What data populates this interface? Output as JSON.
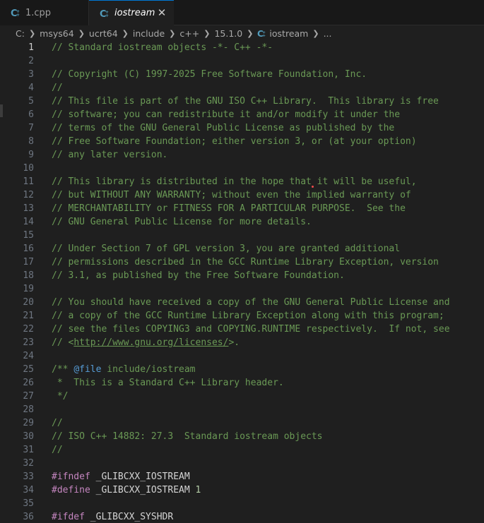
{
  "tabs": [
    {
      "label": "1.cpp",
      "icon": "cpp-file-icon"
    },
    {
      "label": "iostream",
      "icon": "cpp-file-icon",
      "close": "✕"
    }
  ],
  "colors": {
    "cpp_icon": "#519aba",
    "comment": "#6a9955",
    "keyword": "#c586c0",
    "number": "#b5cea8",
    "doc_tag": "#569cd6"
  },
  "breadcrumb": [
    "C:",
    "msys64",
    "ucrt64",
    "include",
    "c++",
    "15.1.0",
    "iostream",
    "..."
  ],
  "lines": [
    {
      "n": "1",
      "text": "// Standard iostream objects -*- C++ -*-"
    },
    {
      "n": "2",
      "text": ""
    },
    {
      "n": "3",
      "text": "// Copyright (C) 1997-2025 Free Software Foundation, Inc."
    },
    {
      "n": "4",
      "text": "//"
    },
    {
      "n": "5",
      "text": "// This file is part of the GNU ISO C++ Library.  This library is free"
    },
    {
      "n": "6",
      "text": "// software; you can redistribute it and/or modify it under the"
    },
    {
      "n": "7",
      "text": "// terms of the GNU General Public License as published by the"
    },
    {
      "n": "8",
      "text": "// Free Software Foundation; either version 3, or (at your option)"
    },
    {
      "n": "9",
      "text": "// any later version."
    },
    {
      "n": "10",
      "text": ""
    },
    {
      "n": "11",
      "text": "// This library is distributed in the hope that it will be useful,"
    },
    {
      "n": "12",
      "text": "// but WITHOUT ANY WARRANTY; without even the implied warranty of"
    },
    {
      "n": "13",
      "text": "// MERCHANTABILITY or FITNESS FOR A PARTICULAR PURPOSE.  See the"
    },
    {
      "n": "14",
      "text": "// GNU General Public License for more details."
    },
    {
      "n": "15",
      "text": ""
    },
    {
      "n": "16",
      "text": "// Under Section 7 of GPL version 3, you are granted additional"
    },
    {
      "n": "17",
      "text": "// permissions described in the GCC Runtime Library Exception, version"
    },
    {
      "n": "18",
      "text": "// 3.1, as published by the Free Software Foundation."
    },
    {
      "n": "19",
      "text": ""
    },
    {
      "n": "20",
      "text": "// You should have received a copy of the GNU General Public License and"
    },
    {
      "n": "21",
      "text": "// a copy of the GCC Runtime Library Exception along with this program;"
    },
    {
      "n": "22",
      "text": "// see the files COPYING3 and COPYING.RUNTIME respectively.  If not, see"
    },
    {
      "n": "23",
      "pre": "// <",
      "link": "http://www.gnu.org/licenses/",
      "post": ">."
    },
    {
      "n": "24",
      "text": ""
    },
    {
      "n": "25",
      "pre": "/** ",
      "tag": "@file",
      "post": " include/iostream"
    },
    {
      "n": "26",
      "text": " *  This is a Standard C++ Library header."
    },
    {
      "n": "27",
      "text": " */"
    },
    {
      "n": "28",
      "text": ""
    },
    {
      "n": "29",
      "text": "//"
    },
    {
      "n": "30",
      "text": "// ISO C++ 14882: 27.3  Standard iostream objects"
    },
    {
      "n": "31",
      "text": "//"
    },
    {
      "n": "32",
      "text": ""
    },
    {
      "n": "33",
      "kw": "#ifndef",
      "ident": " _GLIBCXX_IOSTREAM"
    },
    {
      "n": "34",
      "kw": "#define",
      "ident": " _GLIBCXX_IOSTREAM ",
      "num": "1"
    },
    {
      "n": "35",
      "text": ""
    },
    {
      "n": "36",
      "kw": "#ifdef",
      "ident": " _GLIBCXX_SYSHDR"
    }
  ]
}
